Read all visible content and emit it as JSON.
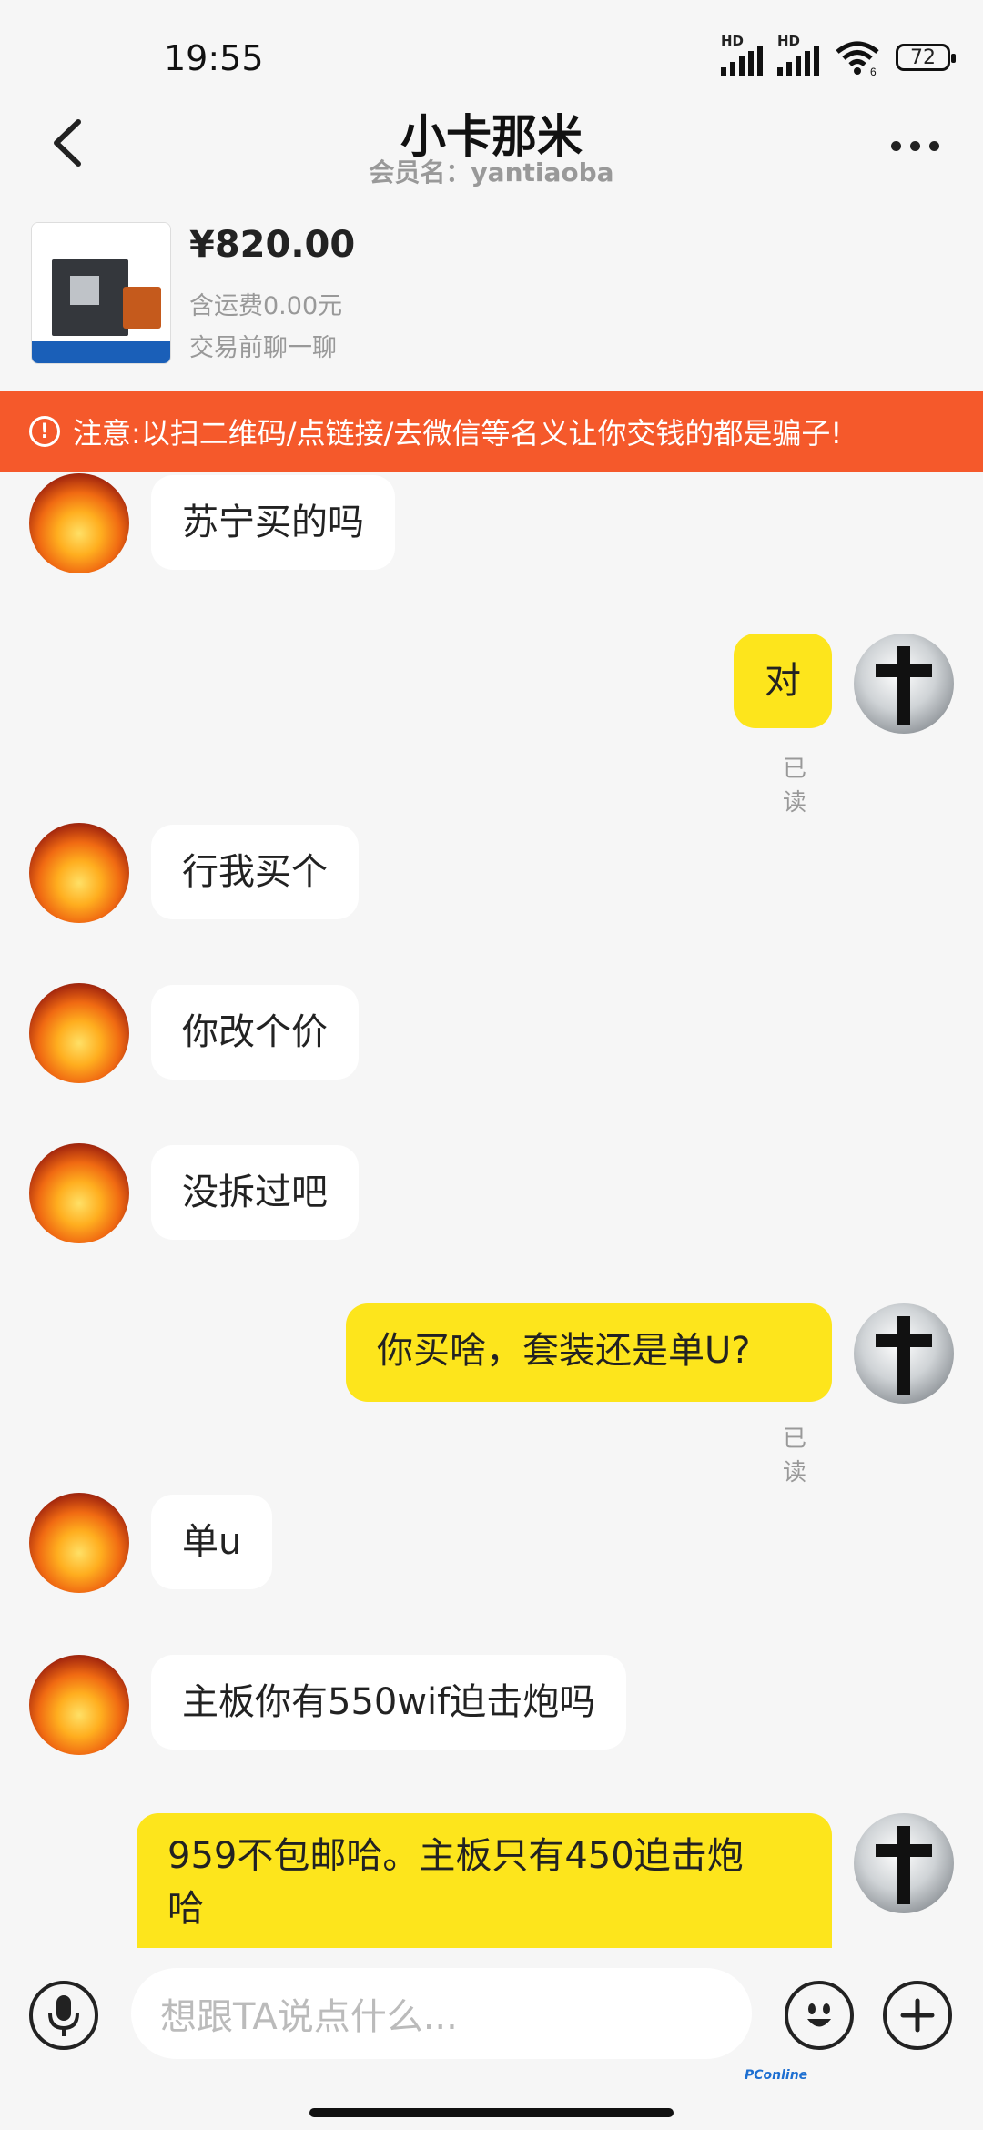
{
  "status_bar": {
    "time": "19:55",
    "network": "HD",
    "wifi_badge": "6",
    "battery": "72"
  },
  "header": {
    "title": "小卡那米",
    "subtitle": "会员名：yantiaoba"
  },
  "product": {
    "price": "¥820.00",
    "shipping": "含运费0.00元",
    "cta": "交易前聊一聊"
  },
  "warning": {
    "text": "注意:以扫二维码/点链接/去微信等名义让你交钱的都是骗子!"
  },
  "messages": [
    {
      "side": "in",
      "text": "苏宁买的吗"
    },
    {
      "side": "out",
      "text": "对",
      "status": "已读"
    },
    {
      "side": "in",
      "text": "行我买个"
    },
    {
      "side": "in",
      "text": "你改个价"
    },
    {
      "side": "in",
      "text": "没拆过吧"
    },
    {
      "side": "out",
      "text": "你买啥，套装还是单U?",
      "status": "已读"
    },
    {
      "side": "in",
      "text": "单u"
    },
    {
      "side": "in",
      "text": "主板你有550wif迫击炮吗"
    },
    {
      "side": "out",
      "text_line1": "959不包邮哈。主板只有450迫击炮",
      "text_line2": "哈"
    }
  ],
  "input": {
    "placeholder": "想跟TA说点什么..."
  },
  "watermark": "PConline",
  "icons": {
    "back": "chevron-left-icon",
    "more": "more-dots-icon",
    "warning": "exclamation-circle-icon",
    "mic": "microphone-icon",
    "emoji": "emoji-icon",
    "plus": "plus-icon"
  },
  "colors": {
    "warning_bg": "#f5592b",
    "out_bubble": "#fde51c",
    "in_bubble": "#ffffff",
    "background": "#f6f6f6"
  }
}
